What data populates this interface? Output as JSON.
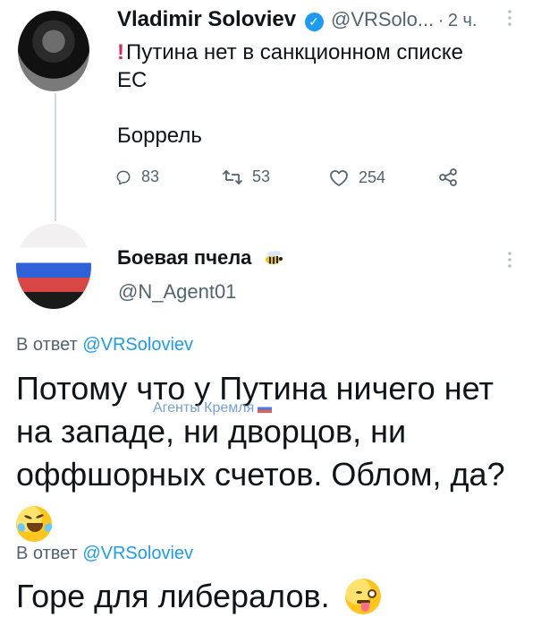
{
  "tweet1": {
    "author_name": "Vladimir Soloviev",
    "handle": "@VRSolo...",
    "time": "2 ч.",
    "line1": "Путина нет в санкционном списке",
    "line2": "ЕС",
    "line3": "Боррель",
    "counts": {
      "replies": "83",
      "retweets": "53",
      "likes": "254"
    }
  },
  "tweet2": {
    "author_name": "Боевая пчела",
    "handle": "@N_Agent01",
    "reply_prefix": "В ответ",
    "reply_target": "@VRSoloviev",
    "watermark": "Агенты Кремля",
    "text_lines": [
      "Потому что у Путина ничего нет",
      "на западе, ни дворцов, ни",
      "оффшорных счетов. Облом, да?"
    ]
  },
  "tweet3": {
    "reply_prefix": "В ответ",
    "reply_target": "@VRSoloviev",
    "text": "Горе для либералов."
  },
  "icons": {
    "verified": "verified-badge-icon",
    "reply": "reply-icon",
    "retweet": "retweet-icon",
    "like": "heart-icon",
    "share": "share-icon",
    "more": "more-icon",
    "bee": "bee-icon",
    "laugh": "rolling-laughing-emoji-icon",
    "wink": "winking-tongue-emoji-icon"
  },
  "colors": {
    "accent": "#1d9bf0",
    "text": "#0f1419",
    "muted": "#536471",
    "exclamation": "#e0245e"
  }
}
